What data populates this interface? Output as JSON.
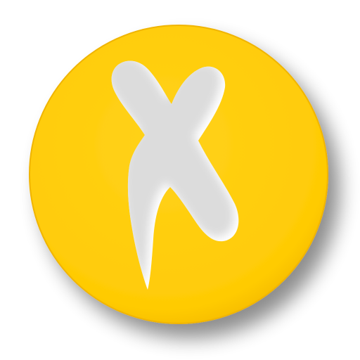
{
  "badge": {
    "icon": "x-letter-badge-icon",
    "shape": "circle",
    "letter_glyph": "hand-drawn-x-cutout",
    "colors": {
      "disc": "#FFCB05",
      "disc_edge": "#F0B400",
      "cutout": "#FFFFFF",
      "shadow": "#9a9a9a",
      "background": "#FFFFFF"
    }
  }
}
